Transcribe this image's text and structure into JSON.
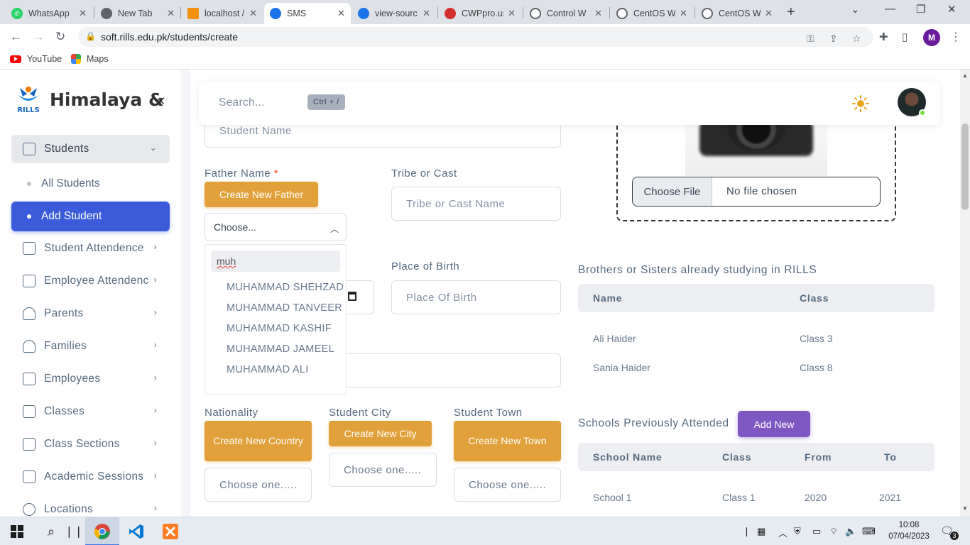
{
  "browser": {
    "tabs": [
      {
        "title": "WhatsApp",
        "icon": "whatsapp-icon",
        "color": "#25d366"
      },
      {
        "title": "New Tab",
        "icon": "chrome-icon",
        "color": "#5f6368"
      },
      {
        "title": "localhost /",
        "icon": "phpmyadmin-icon",
        "color": "#f29111"
      },
      {
        "title": "SMS",
        "icon": "rills-icon",
        "color": "#1a73e8"
      },
      {
        "title": "view-sourc",
        "icon": "rills-icon",
        "color": "#1a73e8"
      },
      {
        "title": "CWPpro.us",
        "icon": "cwp-icon",
        "color": "#d32f2f"
      },
      {
        "title": "Control W",
        "icon": "globe-icon",
        "color": "#5f6368"
      },
      {
        "title": "CentOS W",
        "icon": "globe-icon",
        "color": "#5f6368"
      },
      {
        "title": "CentOS W",
        "icon": "globe-icon",
        "color": "#5f6368"
      }
    ],
    "url": "soft.rills.edu.pk/students/create",
    "profile_initial": "M",
    "bookmarks": [
      {
        "label": "YouTube",
        "icon": "youtube-icon"
      },
      {
        "label": "Maps",
        "icon": "maps-icon"
      }
    ]
  },
  "sidebar": {
    "brand": "Himalaya &",
    "menu": [
      {
        "label": "Students",
        "icon": "layout-icon",
        "open": true
      },
      {
        "label": "Student Attendence",
        "icon": "layout-icon"
      },
      {
        "label": "Employee Attendence",
        "icon": "layout-icon"
      },
      {
        "label": "Parents",
        "icon": "users-icon"
      },
      {
        "label": "Families",
        "icon": "users-icon"
      },
      {
        "label": "Employees",
        "icon": "briefcase-icon"
      },
      {
        "label": "Classes",
        "icon": "monitor-icon"
      },
      {
        "label": "Class Sections",
        "icon": "archive-icon"
      },
      {
        "label": "Academic Sessions",
        "icon": "archive-icon"
      },
      {
        "label": "Locations",
        "icon": "globe-icon"
      }
    ],
    "submenu": [
      {
        "label": "All Students",
        "active": false
      },
      {
        "label": "Add Student",
        "active": true
      }
    ]
  },
  "topnav": {
    "search_placeholder": "Search...",
    "shortcut": "Ctrl + /"
  },
  "form": {
    "student_name_placeholder": "Student Name",
    "father_name_label": "Father Name",
    "required_mark": "*",
    "create_father_button": "Create New Father",
    "father_select_value": "Choose...",
    "father_search_value": "muh",
    "father_options": [
      "MUHAMMAD SHEHZAD",
      "MUHAMMAD TANVEER",
      "MUHAMMAD KASHIF",
      "MUHAMMAD JAMEEL",
      "MUHAMMAD ALI"
    ],
    "tribe_label": "Tribe or Cast",
    "tribe_placeholder": "Tribe or Cast Name",
    "place_of_birth_label": "Place of Birth",
    "place_of_birth_placeholder": "Place Of Birth",
    "nationality_label": "Nationality",
    "create_country_button": "Create New Country",
    "nationality_value": "Choose one.....",
    "city_label": "Student City",
    "create_city_button": "Create New City",
    "city_value": "Choose one.....",
    "town_label": "Student Town",
    "create_town_button": "Create New Town",
    "town_value": "Choose one.....",
    "file_button": "Choose File",
    "file_status": "No file chosen"
  },
  "siblings": {
    "title": "Brothers or Sisters already studying in RILLS",
    "headers": [
      "Name",
      "Class"
    ],
    "rows": [
      [
        "Ali Haider",
        "Class 3"
      ],
      [
        "Sania Haider",
        "Class 8"
      ]
    ]
  },
  "schools": {
    "title": "Schools Previously Attended",
    "add_button": "Add New",
    "headers": [
      "School Name",
      "Class",
      "From",
      "To"
    ],
    "rows": [
      [
        "School 1",
        "Class 1",
        "2020",
        "2021"
      ]
    ]
  },
  "taskbar": {
    "time": "10:08",
    "date": "07/04/2023",
    "notifications": "3"
  },
  "colors": {
    "accent": "#3b5bdb",
    "orange": "#e1a03a",
    "purple": "#7e57c2"
  }
}
